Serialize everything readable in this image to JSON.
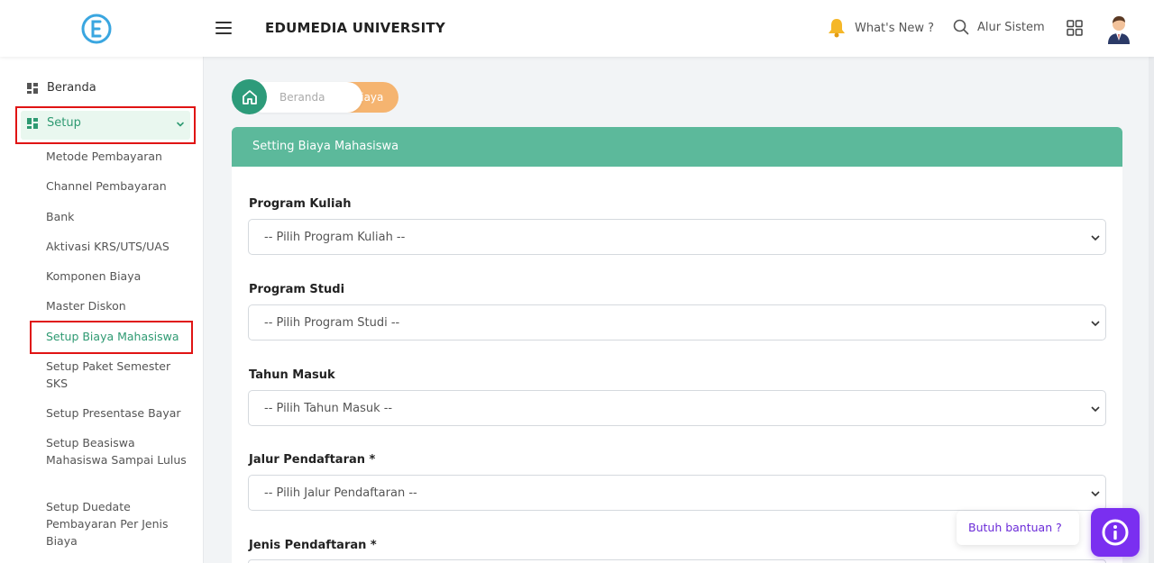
{
  "header": {
    "brand": "EDUMEDIA UNIVERSITY",
    "whats_new": "What's New ?",
    "alur_sistem": "Alur Sistem"
  },
  "sidebar": {
    "beranda": "Beranda",
    "setup": "Setup",
    "submenu": [
      "Metode Pembayaran",
      "Channel Pembayaran",
      "Bank",
      "Aktivasi KRS/UTS/UAS",
      "Komponen Biaya",
      "Master Diskon",
      "Setup Biaya Mahasiswa",
      "Setup Paket Semester SKS",
      "Setup Presentase Bayar",
      "Setup Beasiswa Mahasiswa Sampai Lulus",
      "Setup Duedate Pembayaran Per Jenis Biaya"
    ]
  },
  "breadcrumb": {
    "home": "Beranda",
    "current": "Biaya"
  },
  "card": {
    "title": "Setting Biaya Mahasiswa"
  },
  "form": {
    "fields": [
      {
        "label": "Program Kuliah",
        "placeholder": "-- Pilih Program Kuliah --"
      },
      {
        "label": "Program Studi",
        "placeholder": "-- Pilih Program Studi --"
      },
      {
        "label": "Tahun Masuk",
        "placeholder": "-- Pilih Tahun Masuk --"
      },
      {
        "label": "Jalur Pendaftaran *",
        "placeholder": "-- Pilih Jalur Pendaftaran --"
      },
      {
        "label": "Jenis Pendaftaran *",
        "placeholder": ""
      }
    ]
  },
  "help": {
    "text": "Butuh bantuan ?"
  },
  "colors": {
    "primary": "#2d9b7a",
    "card_header": "#5cb99b",
    "breadcrumb_active": "#f5b470",
    "highlight": "#e01414",
    "help": "#7a2ff0"
  },
  "icons": [
    "logo-icon",
    "hamburger-icon",
    "bell-icon",
    "search-icon",
    "grid-icon",
    "avatar",
    "dashboard-icon",
    "chevron-down-icon",
    "home-icon",
    "info-icon"
  ]
}
